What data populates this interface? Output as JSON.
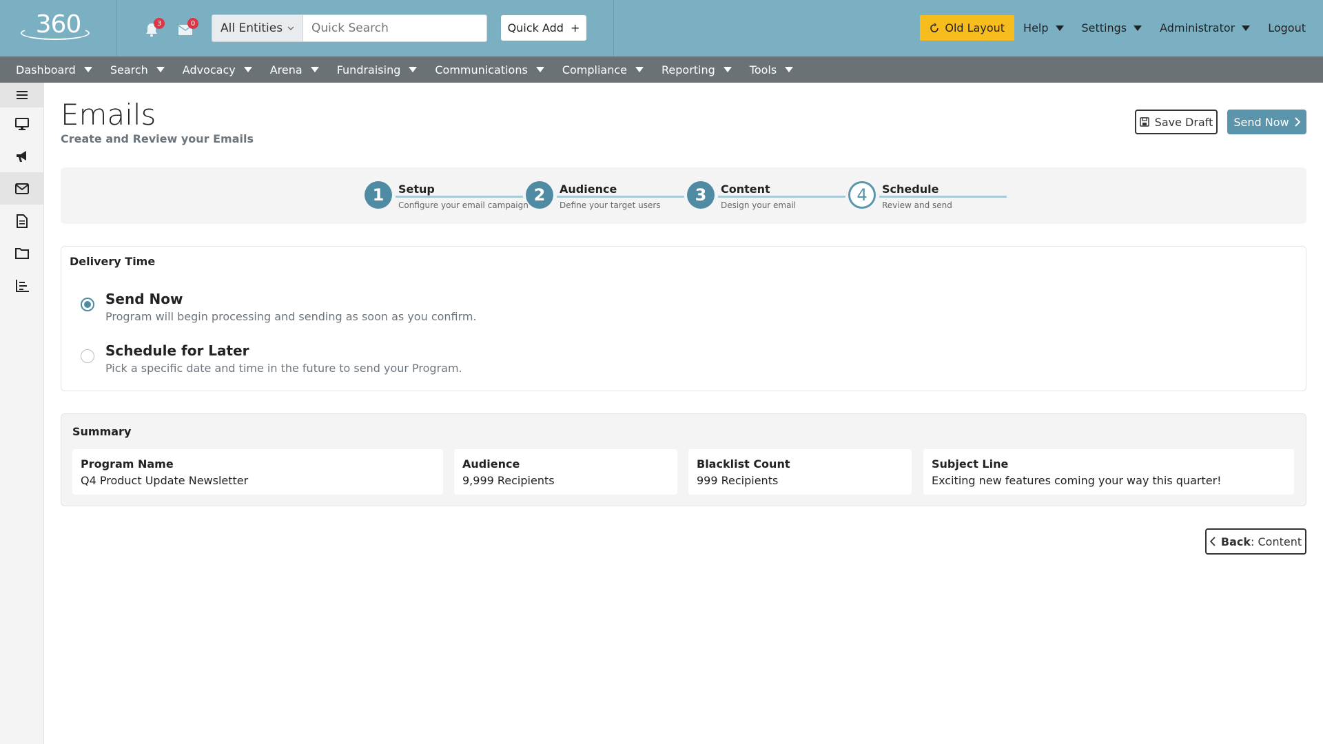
{
  "header": {
    "logo_text": "360",
    "notifications_count": "3",
    "messages_count": "0",
    "entity_select": "All Entities",
    "search_placeholder": "Quick Search",
    "quick_add_label": "Quick Add",
    "quick_add_icon": "+",
    "old_layout_label": "Old Layout",
    "menus": [
      "Help",
      "Settings",
      "Administrator"
    ],
    "logout_label": "Logout",
    "accent_color": "#7bb0c3",
    "highlight_color": "#f7bd1f"
  },
  "nav": {
    "items": [
      "Dashboard",
      "Search",
      "Advocacy",
      "Arena",
      "Fundraising",
      "Communications",
      "Compliance",
      "Reporting",
      "Tools"
    ]
  },
  "sidebar": {
    "icons": [
      "menu-icon",
      "monitor-icon",
      "megaphone-icon",
      "mail-icon",
      "document-icon",
      "folder-icon",
      "chart-icon"
    ],
    "active": "mail-icon"
  },
  "page": {
    "title": "Emails",
    "subtitle": "Create and Review your Emails",
    "save_draft_label": "Save Draft",
    "send_now_label": "Send Now",
    "primary_color": "#5a95ac"
  },
  "steps": [
    {
      "number": "1",
      "title": "Setup",
      "desc": "Configure your email campaign",
      "completed": true
    },
    {
      "number": "2",
      "title": "Audience",
      "desc": "Define your target users",
      "completed": true
    },
    {
      "number": "3",
      "title": "Content",
      "desc": "Design your email",
      "completed": true
    },
    {
      "number": "4",
      "title": "Schedule",
      "desc": "Review and send",
      "completed": false
    }
  ],
  "delivery": {
    "section_label": "Delivery Time",
    "options": [
      {
        "title": "Send Now",
        "desc": "Program will begin processing and sending as soon as you confirm.",
        "selected": true
      },
      {
        "title": "Schedule for Later",
        "desc": "Pick a specific date and time in the future to send your Program.",
        "selected": false
      }
    ]
  },
  "summary": {
    "section_label": "Summary",
    "cards": [
      {
        "label": "Program Name",
        "value": "Q4 Product Update Newsletter"
      },
      {
        "label": "Audience",
        "value": "9,999 Recipients"
      },
      {
        "label": "Blacklist Count",
        "value": "999 Recipients"
      },
      {
        "label": "Subject Line",
        "value": "Exciting new features coming your way this quarter!"
      }
    ]
  },
  "footer": {
    "back_bold": "Back",
    "back_text": ": Content"
  }
}
